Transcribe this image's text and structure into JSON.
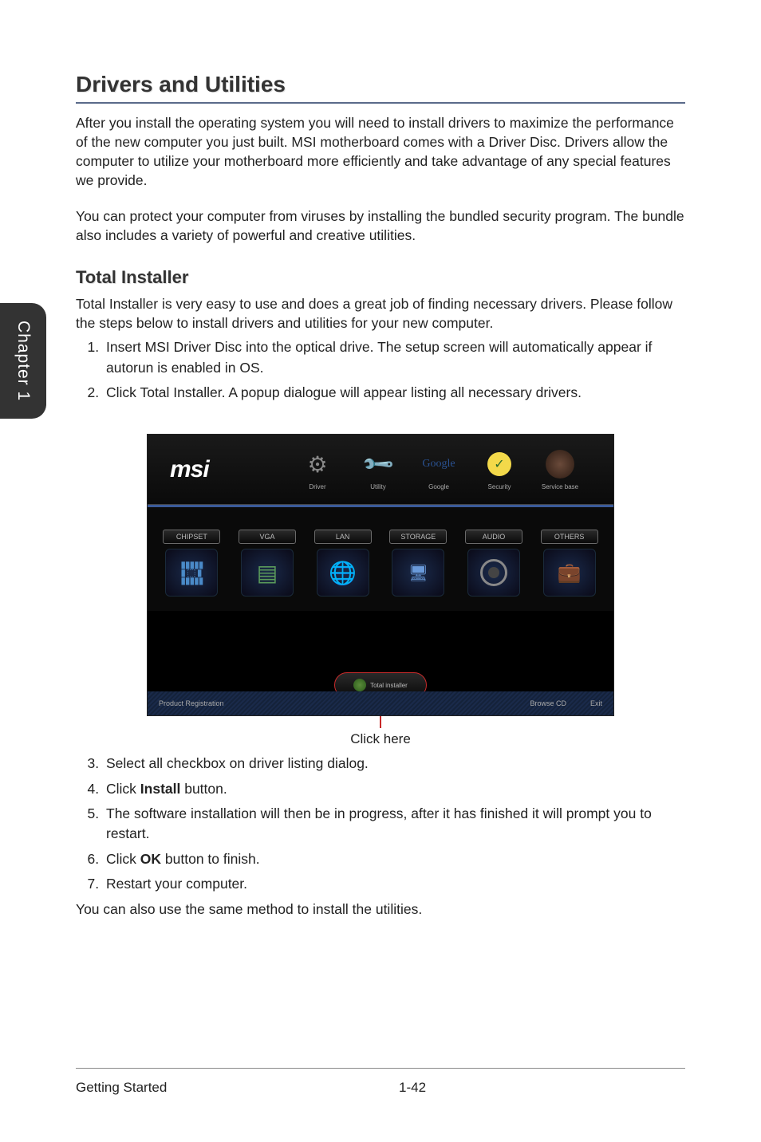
{
  "sideTab": "Chapter 1",
  "heading": "Drivers and Utilities",
  "para1": "After you install the operating system you will need to install drivers to maximize the performance of the new computer you just built. MSI motherboard comes with a Driver Disc. Drivers allow the computer to utilize your motherboard more efficiently and take advantage of any special features we provide.",
  "para2": "You can protect your computer from viruses by installing the bundled security program. The bundle also includes a variety of powerful and creative utilities.",
  "subheading": "Total Installer",
  "para3": "Total Installer is very easy to use and does a great job of finding necessary drivers. Please follow the steps below to install drivers and utilities for your new computer.",
  "steps1": [
    "Insert MSI Driver Disc into the optical drive. The setup screen will automatically appear if autorun is enabled in OS.",
    "Click Total Installer. A popup dialogue will appear listing all necessary drivers."
  ],
  "screenshot": {
    "logo": "msi",
    "topTabs": [
      {
        "label": "Driver"
      },
      {
        "label": "Utility"
      },
      {
        "label": "Google"
      },
      {
        "label": "Security"
      },
      {
        "label": "Service base"
      }
    ],
    "categories": [
      "CHIPSET",
      "VGA",
      "LAN",
      "STORAGE",
      "AUDIO",
      "OTHERS"
    ],
    "totalInstaller": "Total installer",
    "productReg": "Product Registration",
    "browseCD": "Browse CD",
    "exit": "Exit"
  },
  "clickHere": "Click here",
  "steps2": [
    {
      "pre": "Select all checkbox on driver listing dialog."
    },
    {
      "pre": "Click ",
      "bold": "Install",
      "post": " button."
    },
    {
      "pre": "The software installation will then be in progress, after it has finished it will prompt you to restart."
    },
    {
      "pre": "Click ",
      "bold": "OK",
      "post": " button to finish."
    },
    {
      "pre": "Restart your computer."
    }
  ],
  "closing": "You can also use the same method to install the utilities.",
  "footer": {
    "left": "Getting Started",
    "page": "1-42"
  }
}
